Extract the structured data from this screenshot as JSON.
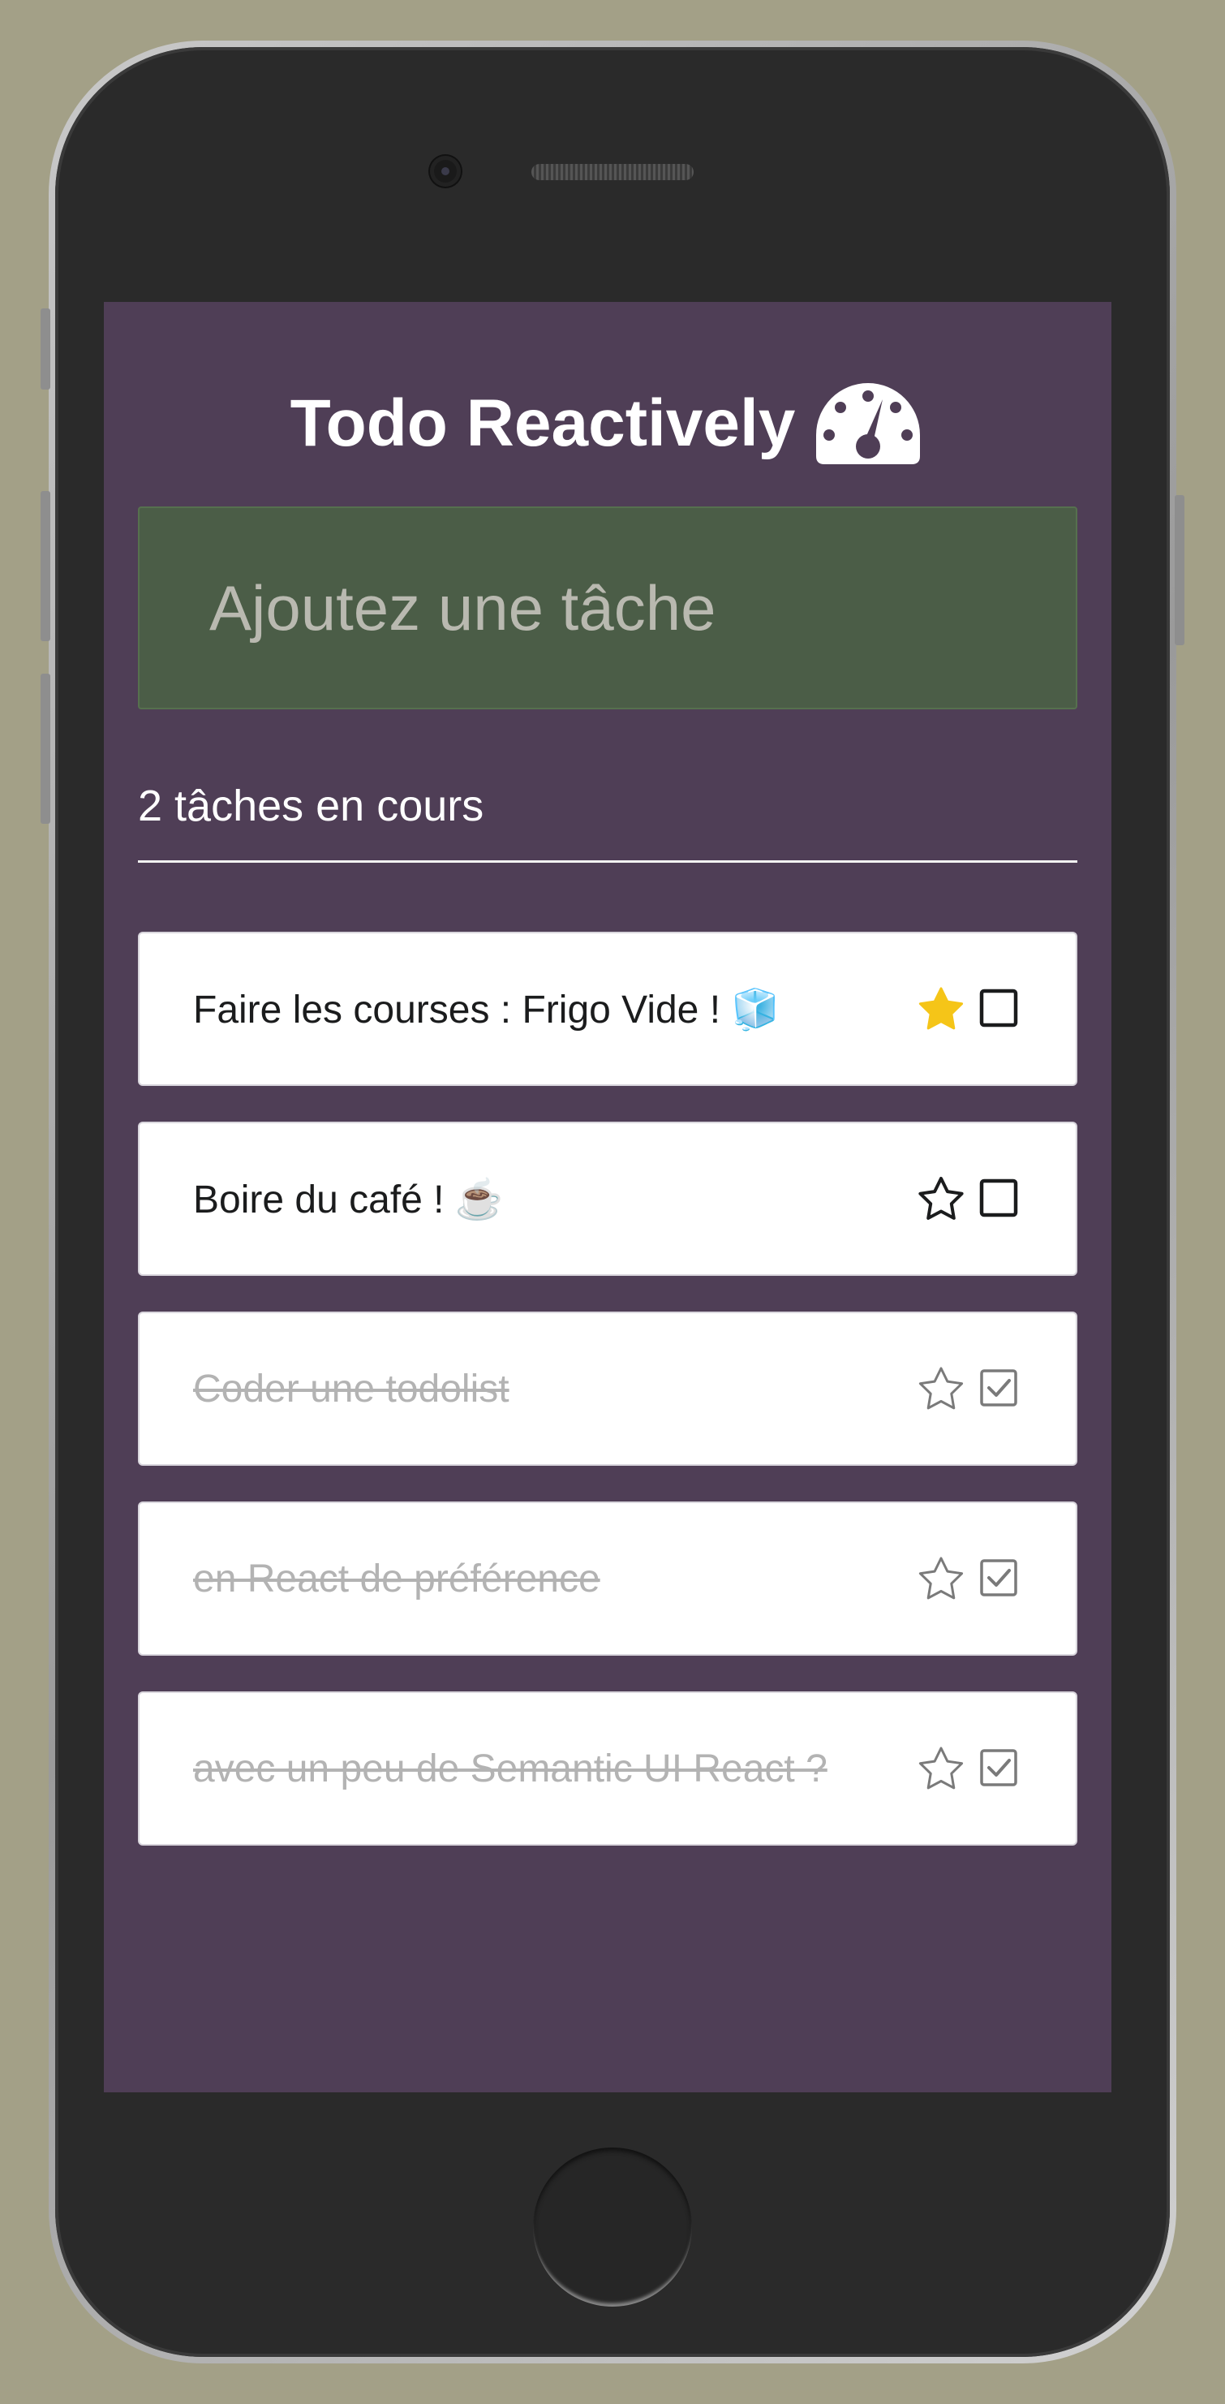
{
  "app": {
    "title": "Todo Reactively",
    "title_icon": "dashboard-gauge-icon"
  },
  "add_task": {
    "placeholder": "Ajoutez une tâche",
    "value": ""
  },
  "counter": "2 tâches en cours",
  "tasks": [
    {
      "label": "Faire les courses : Frigo Vide ! 🧊",
      "starred": true,
      "done": false
    },
    {
      "label": "Boire du café ! ☕",
      "starred": false,
      "done": false
    },
    {
      "label": "Coder une todolist",
      "starred": false,
      "done": true
    },
    {
      "label": "en React de préférence",
      "starred": false,
      "done": true
    },
    {
      "label": "avec un peu de Semantic UI React ?",
      "starred": false,
      "done": true
    }
  ],
  "colors": {
    "screen_bg": "#4f3e56",
    "input_bg": "#4b5d47",
    "star_active": "#f5c518",
    "done_text": "#b3b3b3"
  }
}
